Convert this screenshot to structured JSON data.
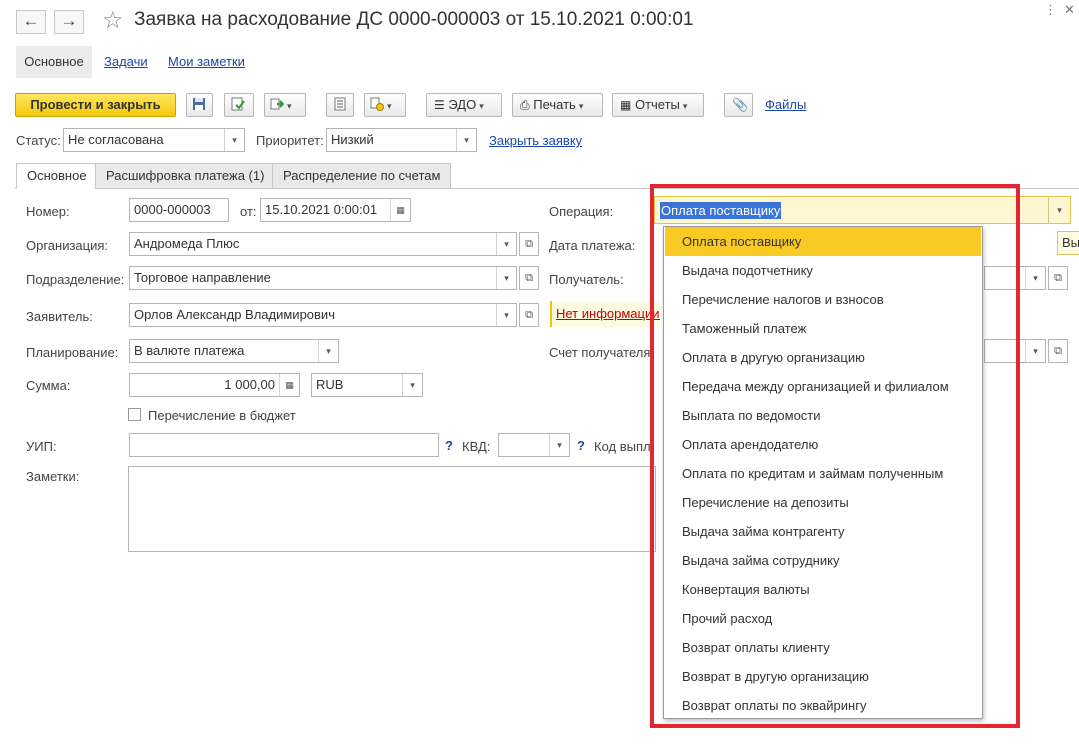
{
  "window": {
    "title": "Заявка на расходование ДС 0000-000003 от 15.10.2021 0:00:01",
    "back_icon": "arrow-left-icon",
    "forward_icon": "arrow-right-icon",
    "favorite_icon": "star-icon"
  },
  "subtabs": {
    "main": "Основное",
    "tasks": "Задачи",
    "notes": "Мои заметки"
  },
  "toolbar": {
    "post_and_close": "Провести и закрыть",
    "edo": "ЭДО",
    "print": "Печать",
    "reports": "Отчеты",
    "files": "Файлы"
  },
  "status_row": {
    "status_label": "Статус:",
    "status_value": "Не согласована",
    "priority_label": "Приоритет:",
    "priority_value": "Низкий",
    "close_request": "Закрыть заявку"
  },
  "tabs": [
    {
      "label": "Основное"
    },
    {
      "label": "Расшифровка платежа (1)"
    },
    {
      "label": "Распределение по счетам"
    }
  ],
  "form": {
    "number_label": "Номер:",
    "number_value": "0000-000003",
    "from_label": "от:",
    "date_value": "15.10.2021  0:00:01",
    "org_label": "Организация:",
    "org_value": "Андромеда Плюс",
    "dept_label": "Подразделение:",
    "dept_value": "Торговое направление",
    "applicant_label": "Заявитель:",
    "applicant_value": "Орлов Александр Владимирович",
    "planning_label": "Планирование:",
    "planning_value": "В валюте платежа",
    "sum_label": "Сумма:",
    "sum_value": "1 000,00",
    "currency_value": "RUB",
    "budget_label": "Перечисление в бюджет",
    "uip_label": "УИП:",
    "kvd_label": "КВД:",
    "kod_label": "Код выплат",
    "notes_label": "Заметки:",
    "operation_label": "Операция:",
    "pay_date_label": "Дата платежа:",
    "recipient_label": "Получатель:",
    "no_info_warning": "Нет информации о",
    "recipient_account_label": "Счет получателя",
    "tooltip_text": "Вы"
  },
  "operation": {
    "value": "Оплата поставщику",
    "options": [
      "Оплата поставщику",
      "Выдача подотчетнику",
      "Перечисление налогов и взносов",
      "Таможенный платеж",
      "Оплата в другую организацию",
      "Передача между организацией и филиалом",
      "Выплата по ведомости",
      "Оплата арендодателю",
      "Оплата по кредитам и займам полученным",
      "Перечисление на депозиты",
      "Выдача займа контрагенту",
      "Выдача займа сотруднику",
      "Конвертация валюты",
      "Прочий расход",
      "Возврат оплаты клиенту",
      "Возврат в другую организацию",
      "Возврат оплаты по эквайрингу"
    ]
  },
  "colors": {
    "primary_button": "#f3c70e",
    "selected_option": "#f9ca24",
    "highlight_frame": "#e32631",
    "link": "#1a48a5"
  }
}
